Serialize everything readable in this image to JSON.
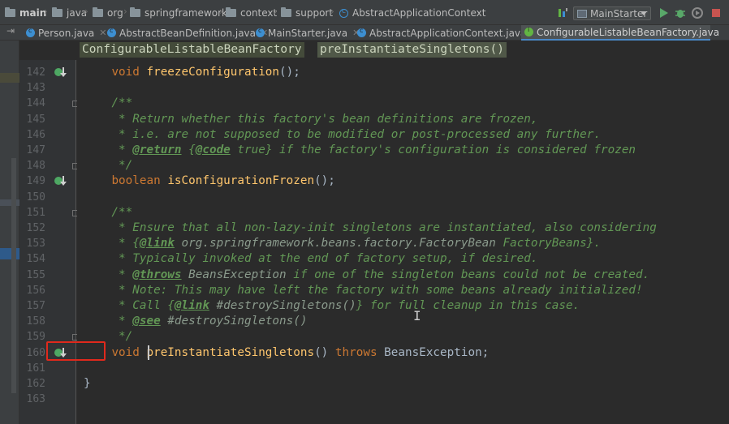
{
  "navbar": {
    "crumbs": [
      "main",
      "java",
      "org",
      "springframework",
      "context",
      "support",
      "AbstractApplicationContext"
    ],
    "run_config": "MainStarter"
  },
  "tabs": [
    {
      "label": "Person.java",
      "kind": "class"
    },
    {
      "label": "AbstractBeanDefinition.java",
      "kind": "class"
    },
    {
      "label": "MainStarter.java",
      "kind": "class"
    },
    {
      "label": "AbstractApplicationContext.java",
      "kind": "class"
    },
    {
      "label": "ConfigurableListableBeanFactory.java",
      "kind": "interface",
      "active": true
    }
  ],
  "editor_breadcrumbs": [
    "ConfigurableListableBeanFactory",
    "preInstantiateSingletons()"
  ],
  "code": {
    "lines": [
      {
        "n": "142",
        "parts": [
          [
            "plain",
            "\t"
          ],
          [
            "kw",
            "void "
          ],
          [
            "fn",
            "freezeConfiguration"
          ],
          [
            "plain",
            "();"
          ]
        ]
      },
      {
        "n": "143",
        "parts": []
      },
      {
        "n": "144",
        "parts": [
          [
            "doc",
            "\t/**"
          ]
        ]
      },
      {
        "n": "145",
        "parts": [
          [
            "doc",
            "\t * Return whether this factory's bean definitions are frozen,"
          ]
        ]
      },
      {
        "n": "146",
        "parts": [
          [
            "doc",
            "\t * i.e. are not supposed to be modified or post-processed any further."
          ]
        ]
      },
      {
        "n": "147",
        "parts": [
          [
            "doc",
            "\t * "
          ],
          [
            "doctag",
            "@return"
          ],
          [
            "doc",
            " {"
          ],
          [
            "doctag",
            "@code"
          ],
          [
            "doc",
            " true} if the factory's configuration is considered frozen"
          ]
        ]
      },
      {
        "n": "148",
        "parts": [
          [
            "doc",
            "\t */"
          ]
        ]
      },
      {
        "n": "149",
        "parts": [
          [
            "plain",
            "\t"
          ],
          [
            "kw",
            "boolean "
          ],
          [
            "fn",
            "isConfigurationFrozen"
          ],
          [
            "plain",
            "();"
          ]
        ]
      },
      {
        "n": "150",
        "parts": []
      },
      {
        "n": "151",
        "parts": [
          [
            "doc",
            "\t/**"
          ]
        ]
      },
      {
        "n": "152",
        "parts": [
          [
            "doc",
            "\t * Ensure that all non-lazy-init singletons are instantiated, also considering"
          ]
        ]
      },
      {
        "n": "153",
        "parts": [
          [
            "doc",
            "\t * {"
          ],
          [
            "doctag",
            "@link"
          ],
          [
            "docref",
            " org.springframework.beans.factory.FactoryBean"
          ],
          [
            "doc",
            " FactoryBeans}."
          ]
        ]
      },
      {
        "n": "154",
        "parts": [
          [
            "doc",
            "\t * Typically invoked at the end of factory setup, if desired."
          ]
        ]
      },
      {
        "n": "155",
        "parts": [
          [
            "doc",
            "\t * "
          ],
          [
            "doctag",
            "@throws"
          ],
          [
            "docref",
            " BeansException"
          ],
          [
            "doc",
            " if one of the singleton beans could not be created."
          ]
        ]
      },
      {
        "n": "156",
        "parts": [
          [
            "doc",
            "\t * Note: This may have left the factory with some beans already initialized!"
          ]
        ]
      },
      {
        "n": "157",
        "parts": [
          [
            "doc",
            "\t * Call {"
          ],
          [
            "doctag",
            "@link"
          ],
          [
            "docref",
            " #destroySingletons()"
          ],
          [
            "doc",
            "} for full cleanup in this case."
          ]
        ]
      },
      {
        "n": "158",
        "parts": [
          [
            "doc",
            "\t * "
          ],
          [
            "doctag",
            "@see"
          ],
          [
            "docref",
            " #destroySingletons()"
          ]
        ]
      },
      {
        "n": "159",
        "parts": [
          [
            "doc",
            "\t */"
          ]
        ]
      },
      {
        "n": "160",
        "parts": [
          [
            "plain",
            "\t"
          ],
          [
            "kw",
            "void "
          ],
          [
            "fn",
            "preInstantiateSingletons"
          ],
          [
            "plain",
            "() "
          ],
          [
            "kw",
            "throws "
          ],
          [
            "plain",
            "BeansException;"
          ]
        ]
      },
      {
        "n": "161",
        "parts": []
      },
      {
        "n": "162",
        "parts": [
          [
            "plain",
            "}"
          ]
        ]
      },
      {
        "n": "163",
        "parts": []
      }
    ]
  }
}
